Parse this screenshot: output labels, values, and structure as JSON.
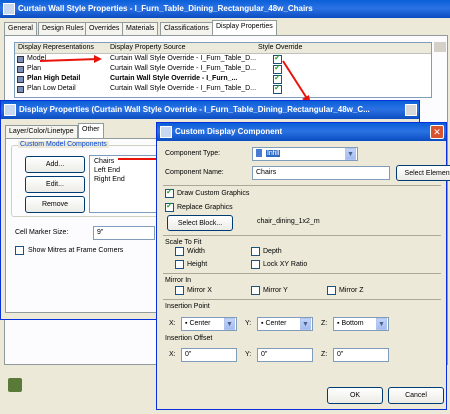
{
  "back_window": {
    "title": "Curtain Wall Style Properties - I_Furn_Table_Dining_Rectangular_48w_Chairs",
    "tabs": [
      "General",
      "Design Rules",
      "Overrides",
      "Materials",
      "Classifications",
      "Display Properties"
    ],
    "columns": [
      "Display Representations",
      "Display Property Source",
      "Style Override"
    ],
    "rows": [
      {
        "rep": "Model",
        "source": "Curtain Wall Style Override - I_Furn_Table_D...",
        "override": true,
        "bold": false
      },
      {
        "rep": "Plan",
        "source": "Curtain Wall Style Override - I_Furn_Table_D...",
        "override": true,
        "bold": false
      },
      {
        "rep": "Plan High Detail",
        "source": "Curtain Wall Style Override - I_Furn_...",
        "override": true,
        "bold": true
      },
      {
        "rep": "Plan Low Detail",
        "source": "Curtain Wall Style Override - I_Furn_Table_D...",
        "override": true,
        "bold": false
      }
    ]
  },
  "mid_window": {
    "title": "Display Properties (Curtain Wall Style Override - I_Furn_Table_Dining_Rectangular_48w_C...",
    "tabs": [
      "Layer/Color/Linetype",
      "Other"
    ],
    "group_label": "Custom Model Components",
    "buttons": {
      "add": "Add...",
      "edit": "Edit...",
      "remove": "Remove"
    },
    "components": [
      "Chairs",
      "Left End",
      "Right End"
    ],
    "cell_marker_label": "Cell Marker Size:",
    "cell_marker_value": "9\"",
    "mitres_label": "Show Mitres at Frame Corners"
  },
  "front_window": {
    "title": "Custom Display Component",
    "component_type_label": "Component Type:",
    "component_type_value": "Infill",
    "component_name_label": "Component Name:",
    "component_name_value": "Chairs",
    "select_element": "Select Element...",
    "draw_custom_graphics": "Draw Custom Graphics",
    "replace_graphics": "Replace Graphics",
    "select_block": "Select Block...",
    "block_name": "chair_dining_1x2_m",
    "scale_to_fit": "Scale To Fit",
    "width": "Width",
    "depth": "Depth",
    "height": "Height",
    "lock_xy": "Lock XY Ratio",
    "mirror_in": "Mirror In",
    "mirror_x": "Mirror X",
    "mirror_y": "Mirror Y",
    "mirror_z": "Mirror Z",
    "insertion_point": "Insertion Point",
    "x_label": "X:",
    "y_label": "Y:",
    "z_label": "Z:",
    "ip_x": "Center",
    "ip_y": "Center",
    "ip_z": "Bottom",
    "insertion_offset": "Insertion Offset",
    "off_x": "0\"",
    "off_y": "0\"",
    "off_z": "0\"",
    "ok": "OK",
    "cancel": "Cancel"
  }
}
